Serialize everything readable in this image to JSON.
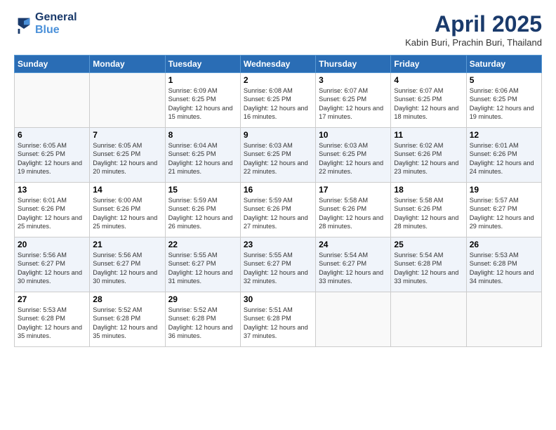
{
  "header": {
    "logo_line1": "General",
    "logo_line2": "Blue",
    "month": "April 2025",
    "location": "Kabin Buri, Prachin Buri, Thailand"
  },
  "days_of_week": [
    "Sunday",
    "Monday",
    "Tuesday",
    "Wednesday",
    "Thursday",
    "Friday",
    "Saturday"
  ],
  "weeks": [
    [
      {
        "day": "",
        "empty": true
      },
      {
        "day": "",
        "empty": true
      },
      {
        "day": "1",
        "sunrise": "6:09 AM",
        "sunset": "6:25 PM",
        "daylight": "12 hours and 15 minutes."
      },
      {
        "day": "2",
        "sunrise": "6:08 AM",
        "sunset": "6:25 PM",
        "daylight": "12 hours and 16 minutes."
      },
      {
        "day": "3",
        "sunrise": "6:07 AM",
        "sunset": "6:25 PM",
        "daylight": "12 hours and 17 minutes."
      },
      {
        "day": "4",
        "sunrise": "6:07 AM",
        "sunset": "6:25 PM",
        "daylight": "12 hours and 18 minutes."
      },
      {
        "day": "5",
        "sunrise": "6:06 AM",
        "sunset": "6:25 PM",
        "daylight": "12 hours and 19 minutes."
      }
    ],
    [
      {
        "day": "6",
        "sunrise": "6:05 AM",
        "sunset": "6:25 PM",
        "daylight": "12 hours and 19 minutes."
      },
      {
        "day": "7",
        "sunrise": "6:05 AM",
        "sunset": "6:25 PM",
        "daylight": "12 hours and 20 minutes."
      },
      {
        "day": "8",
        "sunrise": "6:04 AM",
        "sunset": "6:25 PM",
        "daylight": "12 hours and 21 minutes."
      },
      {
        "day": "9",
        "sunrise": "6:03 AM",
        "sunset": "6:25 PM",
        "daylight": "12 hours and 22 minutes."
      },
      {
        "day": "10",
        "sunrise": "6:03 AM",
        "sunset": "6:25 PM",
        "daylight": "12 hours and 22 minutes."
      },
      {
        "day": "11",
        "sunrise": "6:02 AM",
        "sunset": "6:26 PM",
        "daylight": "12 hours and 23 minutes."
      },
      {
        "day": "12",
        "sunrise": "6:01 AM",
        "sunset": "6:26 PM",
        "daylight": "12 hours and 24 minutes."
      }
    ],
    [
      {
        "day": "13",
        "sunrise": "6:01 AM",
        "sunset": "6:26 PM",
        "daylight": "12 hours and 25 minutes."
      },
      {
        "day": "14",
        "sunrise": "6:00 AM",
        "sunset": "6:26 PM",
        "daylight": "12 hours and 25 minutes."
      },
      {
        "day": "15",
        "sunrise": "5:59 AM",
        "sunset": "6:26 PM",
        "daylight": "12 hours and 26 minutes."
      },
      {
        "day": "16",
        "sunrise": "5:59 AM",
        "sunset": "6:26 PM",
        "daylight": "12 hours and 27 minutes."
      },
      {
        "day": "17",
        "sunrise": "5:58 AM",
        "sunset": "6:26 PM",
        "daylight": "12 hours and 28 minutes."
      },
      {
        "day": "18",
        "sunrise": "5:58 AM",
        "sunset": "6:26 PM",
        "daylight": "12 hours and 28 minutes."
      },
      {
        "day": "19",
        "sunrise": "5:57 AM",
        "sunset": "6:27 PM",
        "daylight": "12 hours and 29 minutes."
      }
    ],
    [
      {
        "day": "20",
        "sunrise": "5:56 AM",
        "sunset": "6:27 PM",
        "daylight": "12 hours and 30 minutes."
      },
      {
        "day": "21",
        "sunrise": "5:56 AM",
        "sunset": "6:27 PM",
        "daylight": "12 hours and 30 minutes."
      },
      {
        "day": "22",
        "sunrise": "5:55 AM",
        "sunset": "6:27 PM",
        "daylight": "12 hours and 31 minutes."
      },
      {
        "day": "23",
        "sunrise": "5:55 AM",
        "sunset": "6:27 PM",
        "daylight": "12 hours and 32 minutes."
      },
      {
        "day": "24",
        "sunrise": "5:54 AM",
        "sunset": "6:27 PM",
        "daylight": "12 hours and 33 minutes."
      },
      {
        "day": "25",
        "sunrise": "5:54 AM",
        "sunset": "6:28 PM",
        "daylight": "12 hours and 33 minutes."
      },
      {
        "day": "26",
        "sunrise": "5:53 AM",
        "sunset": "6:28 PM",
        "daylight": "12 hours and 34 minutes."
      }
    ],
    [
      {
        "day": "27",
        "sunrise": "5:53 AM",
        "sunset": "6:28 PM",
        "daylight": "12 hours and 35 minutes."
      },
      {
        "day": "28",
        "sunrise": "5:52 AM",
        "sunset": "6:28 PM",
        "daylight": "12 hours and 35 minutes."
      },
      {
        "day": "29",
        "sunrise": "5:52 AM",
        "sunset": "6:28 PM",
        "daylight": "12 hours and 36 minutes."
      },
      {
        "day": "30",
        "sunrise": "5:51 AM",
        "sunset": "6:28 PM",
        "daylight": "12 hours and 37 minutes."
      },
      {
        "day": "",
        "empty": true
      },
      {
        "day": "",
        "empty": true
      },
      {
        "day": "",
        "empty": true
      }
    ]
  ],
  "labels": {
    "sunrise_prefix": "Sunrise: ",
    "sunset_prefix": "Sunset: ",
    "daylight_prefix": "Daylight: "
  }
}
